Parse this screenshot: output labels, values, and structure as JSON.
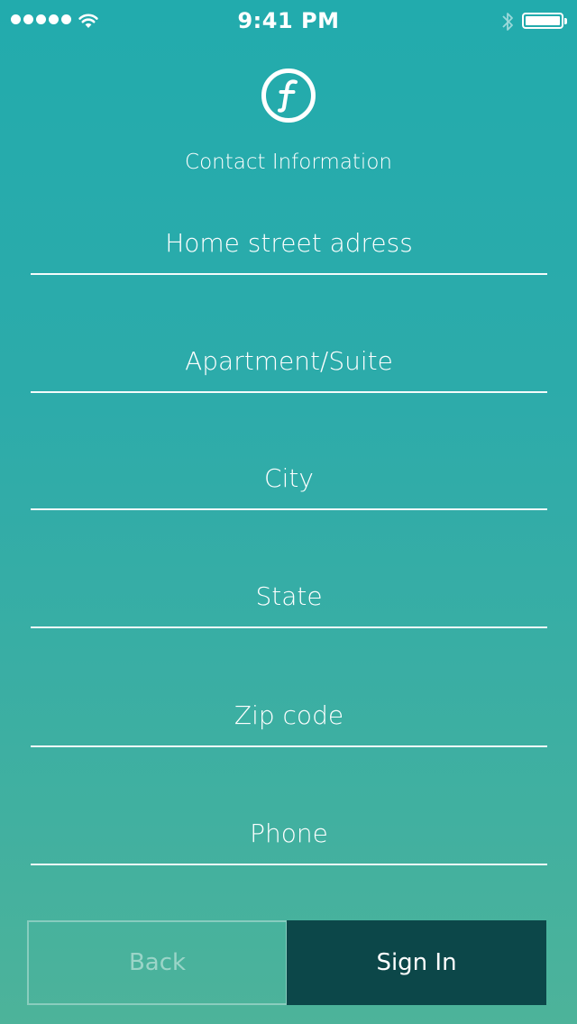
{
  "status_bar": {
    "time": "9:41 PM",
    "signal_icon": "signal-dots-icon",
    "wifi_icon": "wifi-icon",
    "bluetooth_icon": "bluetooth-icon",
    "battery_icon": "battery-icon",
    "battery_level": 1.0
  },
  "header": {
    "logo_icon": "f-circle-logo-icon",
    "title": "Contact Information"
  },
  "form": {
    "fields": [
      {
        "placeholder": "Home street adress",
        "value": ""
      },
      {
        "placeholder": "Apartment/Suite",
        "value": ""
      },
      {
        "placeholder": "City",
        "value": ""
      },
      {
        "placeholder": "State",
        "value": ""
      },
      {
        "placeholder": "Zip code",
        "value": ""
      },
      {
        "placeholder": "Phone",
        "value": ""
      }
    ]
  },
  "buttons": {
    "back_label": "Back",
    "signin_label": "Sign In"
  },
  "colors": {
    "background_top": "#22abad",
    "background_bottom": "#4db39a",
    "primary_button": "#0c4749",
    "text": "#ffffff"
  }
}
